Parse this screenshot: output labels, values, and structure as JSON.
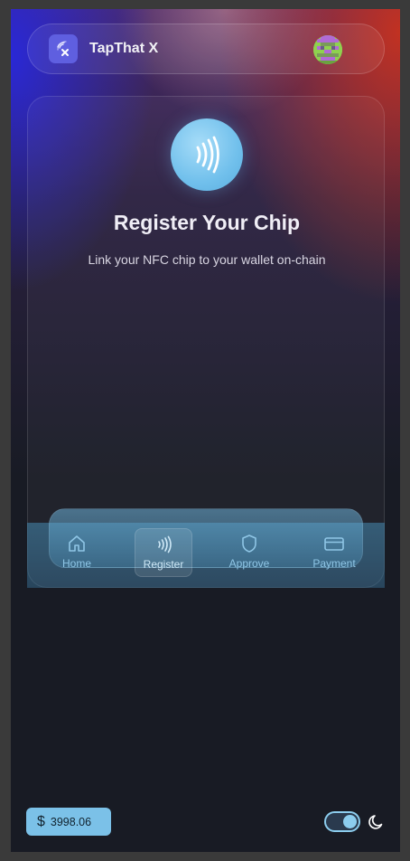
{
  "header": {
    "app_name": "TapThat X",
    "logo_icon": "nfc-x-icon",
    "avatar_icon": "pixel-avatar-icon"
  },
  "main": {
    "chip_icon": "contactless-icon",
    "title": "Register Your Chip",
    "subtitle": "Link your NFC chip to your wallet on-chain"
  },
  "nav": {
    "items": [
      {
        "label": "Home",
        "icon": "home-icon",
        "active": false
      },
      {
        "label": "Register",
        "icon": "contactless-icon",
        "active": true
      },
      {
        "label": "Approve",
        "icon": "shield-icon",
        "active": false
      },
      {
        "label": "Payment",
        "icon": "card-icon",
        "active": false
      }
    ]
  },
  "footer": {
    "balance": "3998.06",
    "currency_symbol": "$",
    "theme_toggle_on": true,
    "theme_icon": "moon-icon"
  },
  "colors": {
    "accent": "#7bc1e8",
    "logo_bg": "#5f5fe0",
    "background": "#181b24"
  }
}
